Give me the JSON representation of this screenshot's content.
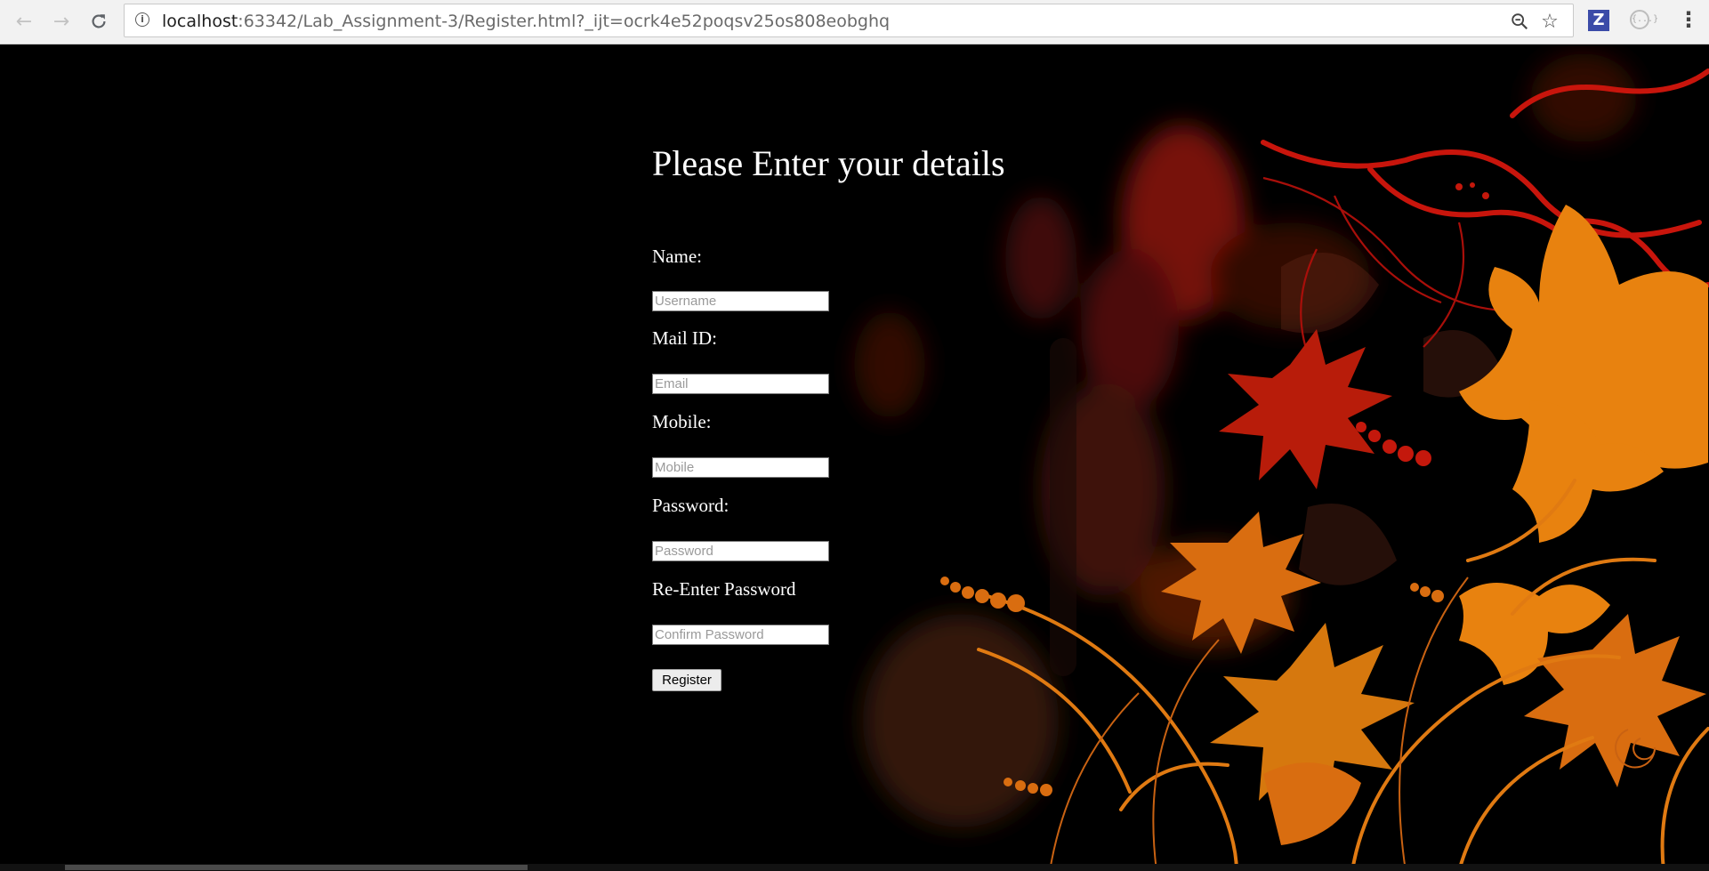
{
  "browser": {
    "url_host": "localhost",
    "url_path": ":63342/Lab_Assignment-3/Register.html?_ijt=ocrk4e52poqsv25os808eobghq",
    "back_icon": "back-arrow-icon",
    "forward_icon": "forward-arrow-icon",
    "reload_icon": "reload-icon",
    "info_icon": "info-icon",
    "zoom_icon": "zoom-icon",
    "bookmark_icon": "star-icon",
    "extension_z_label": "Z",
    "extension_code_label": "{...}",
    "menu_icon": "kebab-menu-icon"
  },
  "form": {
    "heading": "Please Enter your details",
    "name_label": "Name:",
    "name_placeholder": "Username",
    "mail_label": "Mail ID:",
    "mail_placeholder": "Email",
    "mobile_label": "Mobile:",
    "mobile_placeholder": "Mobile",
    "password_label": "Password:",
    "password_placeholder": "Password",
    "confirm_label": "Re-Enter Password",
    "confirm_placeholder": "Confirm Password",
    "register_button": "Register"
  },
  "colors": {
    "page_background": "#000000",
    "text": "#ffffff",
    "art_orange": "#e8820f",
    "art_red": "#c4180c"
  }
}
